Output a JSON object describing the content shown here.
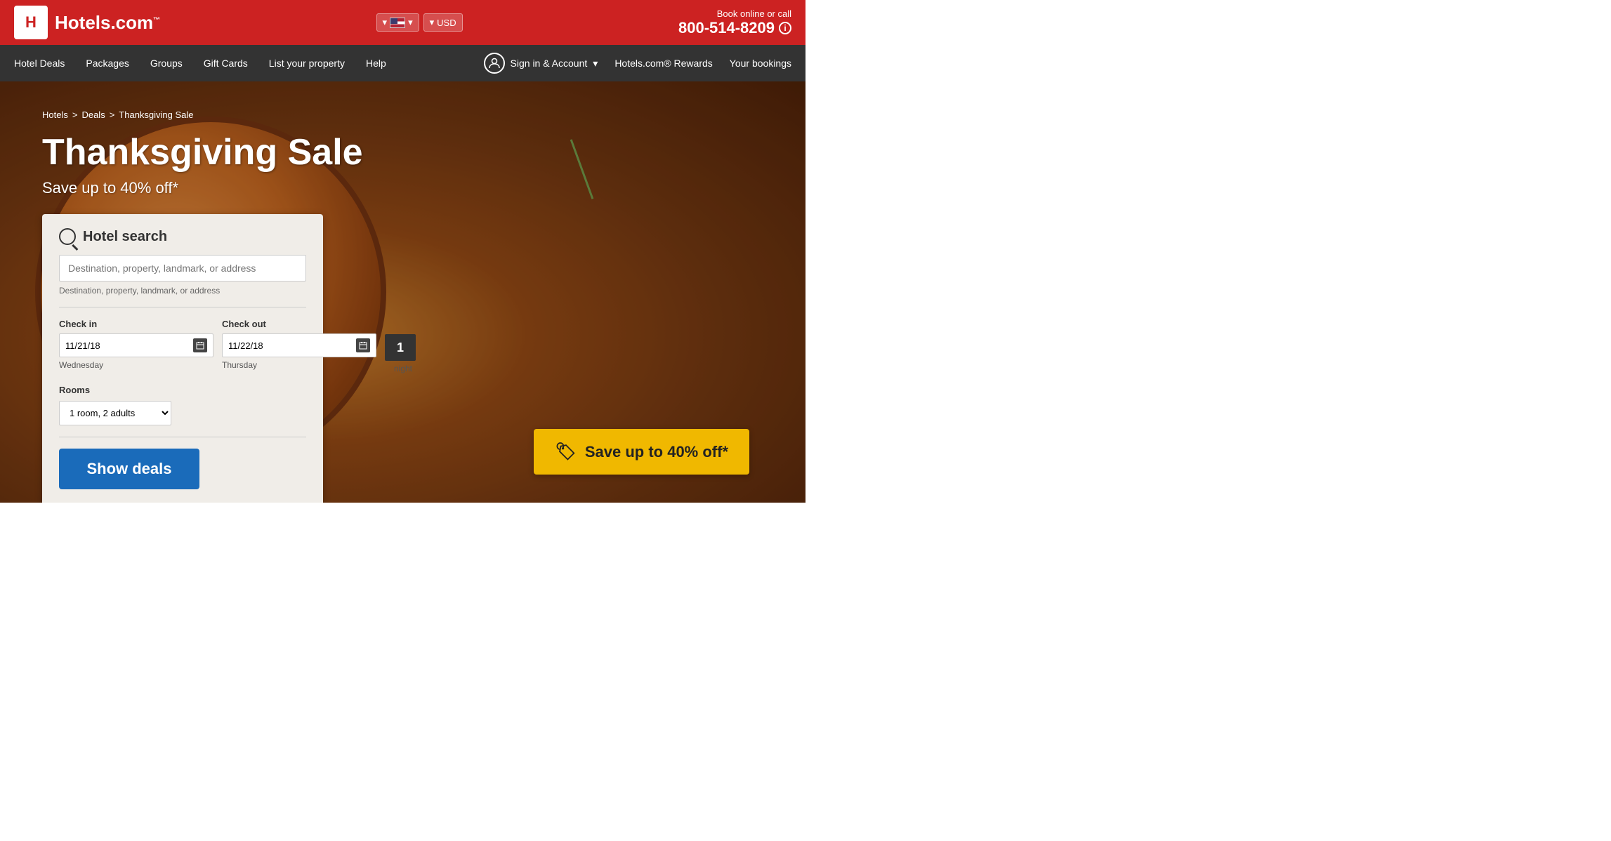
{
  "topbar": {
    "logo_text": "Hotels.com",
    "logo_sup": "™",
    "book_online": "Book online or call",
    "phone": "800-514-8209",
    "lang_arrow": "▾",
    "currency": "USD",
    "currency_arrow": "▾"
  },
  "nav": {
    "items": [
      {
        "label": "Hotel Deals",
        "id": "hotel-deals"
      },
      {
        "label": "Packages",
        "id": "packages"
      },
      {
        "label": "Groups",
        "id": "groups"
      },
      {
        "label": "Gift Cards",
        "id": "gift-cards"
      },
      {
        "label": "List your property",
        "id": "list-property"
      },
      {
        "label": "Help",
        "id": "help"
      }
    ],
    "sign_in": "Sign in & Account",
    "rewards": "Hotels.com® Rewards",
    "bookings": "Your bookings",
    "chevron": "▾"
  },
  "breadcrumb": {
    "items": [
      "Hotels",
      "Deals",
      "Thanksgiving Sale"
    ],
    "sep": ">"
  },
  "hero": {
    "title": "Thanksgiving Sale",
    "subtitle": "Save up to 40% off*"
  },
  "search": {
    "title": "Hotel search",
    "placeholder": "Destination, property, landmark, or address",
    "checkin_label": "Check in",
    "checkin_value": "11/21/18",
    "checkin_day": "Wednesday",
    "checkout_label": "Check out",
    "checkout_value": "11/22/18",
    "checkout_day": "Thursday",
    "nights_num": "1",
    "nights_label": "night",
    "rooms_label": "Rooms",
    "rooms_value": "1 room, 2 adults",
    "show_deals": "Show deals"
  },
  "save_badge": {
    "text": "Save up to 40% off*"
  }
}
